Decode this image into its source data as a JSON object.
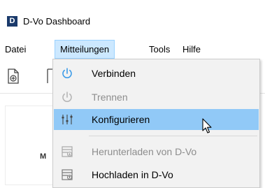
{
  "window": {
    "logo_letter": "D",
    "title": "D-Vo Dashboard"
  },
  "menubar": {
    "items": [
      {
        "label": "Datei"
      },
      {
        "label": "Mitteilungen",
        "active": true
      },
      {
        "label": "Tools"
      },
      {
        "label": "Hilfe"
      }
    ]
  },
  "toolbar": {
    "icons": [
      "add-document-icon",
      "document-icon"
    ]
  },
  "content": {
    "partial_label": "M"
  },
  "dropdown": {
    "items": [
      {
        "label": "Verbinden",
        "icon": "power-icon",
        "enabled": true,
        "hover": false
      },
      {
        "label": "Trennen",
        "icon": "power-icon",
        "enabled": false,
        "hover": false
      },
      {
        "label": "Konfigurieren",
        "icon": "sliders-icon",
        "enabled": true,
        "hover": true
      },
      {
        "label": "Herunterladen von D-Vo",
        "icon": "download-icon",
        "enabled": false,
        "hover": false
      },
      {
        "label": "Hochladen in D-Vo",
        "icon": "upload-icon",
        "enabled": true,
        "hover": false
      }
    ]
  },
  "colors": {
    "accent_blue": "#3c9be8",
    "hover_blue": "#91c9f7",
    "menu_active": "#cce8ff",
    "logo_navy": "#1a3a6b",
    "disabled_text": "#8d8d8d"
  }
}
